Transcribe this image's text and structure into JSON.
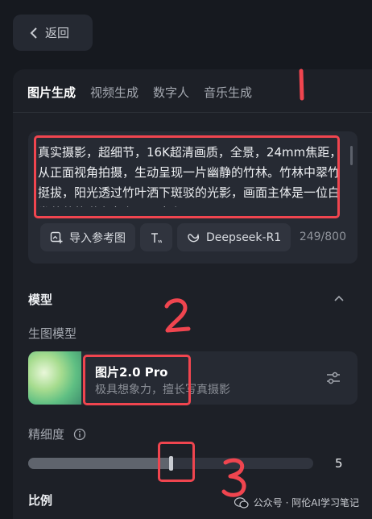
{
  "back_label": "返回",
  "tabs": [
    "图片生成",
    "视频生成",
    "数字人",
    "音乐生成"
  ],
  "prompt": {
    "text": "真实摄影，超细节，16K超清画质，全景，24mm焦距，从正面视角拍摄，生动呈现一片幽静的竹林。竹林中翠竹挺拔，阳光透过竹叶洒下斑驳的光影，画面主体是一位白发苍苍的道家老者，面容和",
    "counter": "249/800"
  },
  "tools": {
    "import_ref": "导入参考图",
    "deepseek": "Deepseek-R1"
  },
  "model_section": {
    "title": "模型",
    "sub_label": "生图模型",
    "name": "图片2.0 Pro",
    "desc": "极具想象力，擅长写真摄影"
  },
  "detail": {
    "label": "精细度",
    "value": "5",
    "level": 0.5
  },
  "ratio": {
    "title": "比例"
  },
  "watermark": "公众号 · 阿伦AI学习笔记",
  "colors": {
    "annotation": "#f0454f",
    "background": "#16191f",
    "panel": "#1d2027"
  }
}
